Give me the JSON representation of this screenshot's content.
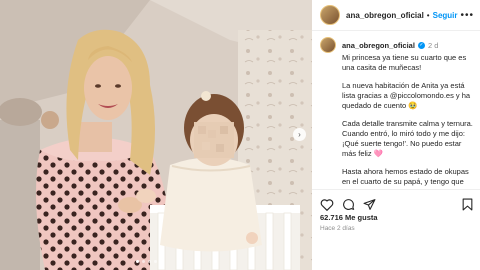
{
  "post": {
    "username": "ana_obregon_oficial",
    "separator": "•",
    "follow_label": "Seguir",
    "more_label": "•••",
    "caption": {
      "username": "ana_obregon_oficial",
      "verified_mark": "✓",
      "time": "2 d",
      "paragraphs": [
        "Mi princesa ya tiene su cuarto que es una casita de muñecas!",
        "La nueva habitación de Anita ya está lista gracias a @piccolomondo.es y ha quedado de cuento 🥹",
        "Cada detalle transmite calma y ternura. Cuando entró, lo miró todo y me dijo: ¡Qué suerte tengo!'. No puedo estar más feliz 🩷",
        "Hasta ahora hemos estado de okupas en el cuarto de su papá, y tengo que reconocer que aún no he sido capaz de"
      ]
    },
    "likes": "62.716 Me gusta",
    "time_ago": "Hace 2 días",
    "next_arrow": "›"
  },
  "icons": {
    "like": "heart-icon",
    "comment": "comment-icon",
    "share": "share-icon",
    "save": "bookmark-icon"
  },
  "carousel": {
    "count": 5,
    "active_index": 0
  },
  "colors": {
    "link": "#0095f6",
    "wall": "#ddd2c8",
    "dress": "#f0c6c0"
  }
}
